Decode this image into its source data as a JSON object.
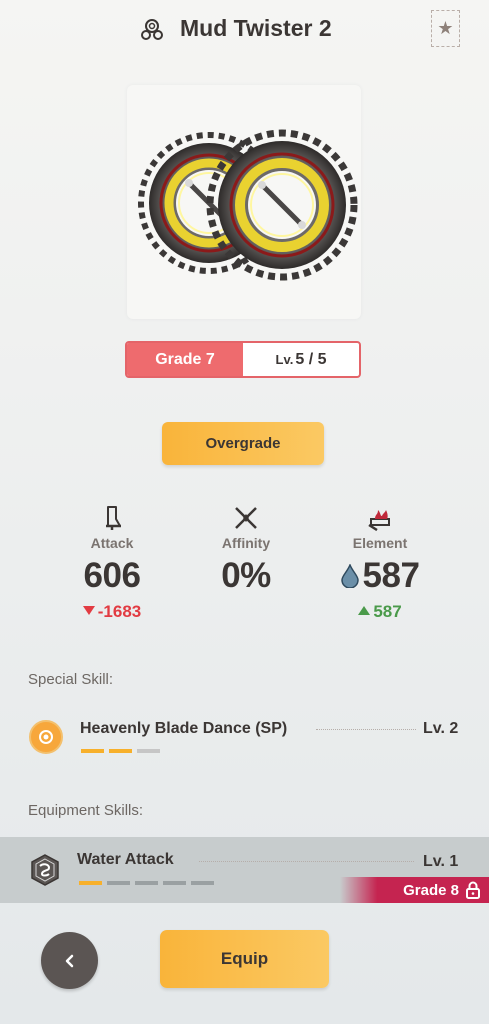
{
  "header": {
    "title": "Mud Twister 2",
    "title_icon": "weapon-type-icon",
    "favorite_icon": "star-icon"
  },
  "grade": {
    "grade_label": "Grade 7",
    "level_prefix": "Lv.",
    "level_value": "5 / 5"
  },
  "overgrade_label": "Overgrade",
  "stats": [
    {
      "icon": "sword-icon",
      "label": "Attack",
      "value": "606",
      "delta": "-1683",
      "direction": "down"
    },
    {
      "icon": "crossed-blades-icon",
      "label": "Affinity",
      "value": "0%",
      "delta": "",
      "direction": ""
    },
    {
      "icon": "flaming-blade-icon",
      "label": "Element",
      "value": "587",
      "delta": "587",
      "direction": "up",
      "element_icon": "water-drop-icon"
    }
  ],
  "special_skill": {
    "section_label": "Special Skill:",
    "name": "Heavenly Blade Dance (SP)",
    "level": "Lv. 2",
    "pips_filled": 2,
    "pips_total": 3
  },
  "equipment_skills": {
    "section_label": "Equipment Skills:",
    "items": [
      {
        "name": "Water Attack",
        "level": "Lv. 1",
        "pips_filled": 1,
        "pips_total": 5,
        "lock_label": "Grade 8",
        "icon": "water-attack-skill-icon"
      }
    ]
  },
  "buttons": {
    "back_icon": "chevron-left-icon",
    "equip_label": "Equip"
  },
  "colors": {
    "accent_orange": "#f9b43a",
    "grade_red": "#ee6b6e",
    "delta_down": "#e23b42",
    "delta_up": "#4a9a4a",
    "lock_badge": "#c52450"
  }
}
